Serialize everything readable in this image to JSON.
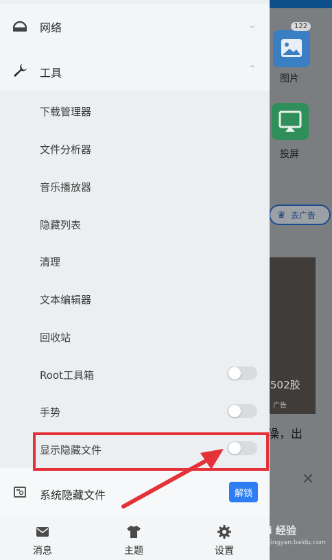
{
  "background": {
    "pictures_badge": "122",
    "pictures_label": "图片",
    "cast_label": "投屏",
    "remove_ads_label": "去广告",
    "photo_text": "502胶",
    "photo_ad": "广告",
    "caption": "澡，出",
    "watermark": "Bai 经验",
    "watermark_url": "jingyan.baidu.com"
  },
  "drawer": {
    "network": {
      "label": "网络",
      "icon": "router-icon"
    },
    "tools": {
      "label": "工具",
      "icon": "wrench-icon"
    },
    "tool_items": [
      {
        "label": "下载管理器"
      },
      {
        "label": "文件分析器"
      },
      {
        "label": "音乐播放器"
      },
      {
        "label": "隐藏列表"
      },
      {
        "label": "清理"
      },
      {
        "label": "文本编辑器"
      },
      {
        "label": "回收站"
      },
      {
        "label": "Root工具箱",
        "toggle": false
      },
      {
        "label": "手势",
        "toggle": false
      },
      {
        "label": "显示隐藏文件",
        "toggle": false
      }
    ],
    "system_hidden": {
      "label": "系统隐藏文件",
      "button": "解锁"
    }
  },
  "bottom_nav": [
    {
      "label": "消息",
      "icon": "message-icon"
    },
    {
      "label": "主题",
      "icon": "shirt-icon"
    },
    {
      "label": "设置",
      "icon": "gear-icon"
    }
  ],
  "colors": {
    "highlight": "#e53238",
    "accent": "#2f7df2"
  }
}
